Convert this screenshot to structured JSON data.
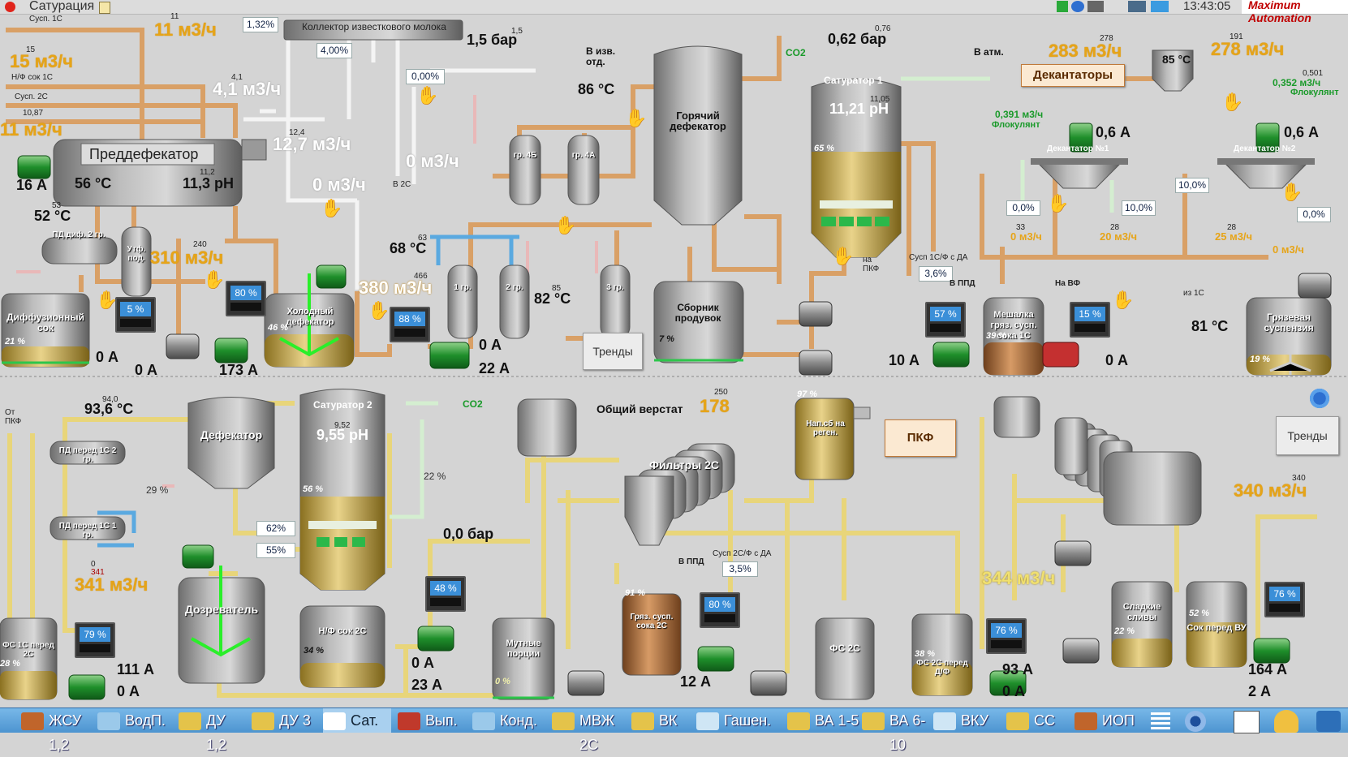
{
  "window": {
    "title": "Сатурация",
    "clock": "13:43:05",
    "logo": "Maximum Automation"
  },
  "top": {
    "collector": "Коллектор известкового молока",
    "predefecator": "Преддефекатор",
    "predefecator_temp": "56 °C",
    "predefecator_ph": "11,3 pH",
    "predefecator_ph_sp": "11,2",
    "flow_susp1c": "11 м3/ч",
    "flow_susp1c_sp": "11",
    "susp1c_label": "Сусп. 1С",
    "flow_nf": "15 м3/ч",
    "flow_nf_sp": "15",
    "nf_label": "Н/Ф сок 1С",
    "flow_susp2c": "11 м3/ч",
    "susp2c_label": "Сусп. 2С",
    "susp2c_sp": "10,87",
    "flow_lime": "4,1 м3/ч",
    "flow_lime_sp": "4,1",
    "flow_127": "12,7 м3/ч",
    "flow_127_sp": "12,4",
    "flow_0a": "0 м3/ч",
    "flow_0b": "0 м3/ч",
    "v2c_label": "В 2С",
    "pressure_15": "1,5 бар",
    "pressure_15_sp": "1,5",
    "to_lime": "В изв. отд.",
    "pct_132": "1,32%",
    "pct_400": "4,00%",
    "pct_000": "0,00%",
    "motor_16a": "16 А",
    "temp_52": "52 °C",
    "temp_52_sp": "53",
    "pd_dif": "ПД диф. 2 гр.",
    "utf": "Утф. под.",
    "flow_310": "310 м3/ч",
    "flow_310_sp": "240",
    "diffusion": "Диффузионный сок",
    "diffusion_pct": "21 %",
    "cold_def": "Холодный дефекатор",
    "cold_pct": "46 %",
    "flow_380": "380 м3/ч",
    "flow_380_sp": "466",
    "temp_68": "68 °C",
    "temp_68_sp": "63",
    "temp_82": "82 °C",
    "temp_82_sp": "85",
    "temp_86": "86 °C",
    "gr1": "1 гр.",
    "gr2": "2 гр.",
    "gr3": "3 гр.",
    "gr4b": "гр. 4Б",
    "gr4a": "гр. 4А",
    "hot_def": "Горячий дефекатор",
    "collector_def": "Сборник продувок",
    "collector_pct": "7 %",
    "trends1": "Тренды",
    "co2": "CO2",
    "to_atm": "В атм.",
    "pressure_062": "0,62 бар",
    "pressure_062_sp": "0,76",
    "saturator1": "Сатуратор 1",
    "sat1_ph": "11,21 pH",
    "sat1_ph_sp": "11,05",
    "sat1_pct": "65 %",
    "to_pkf": "на ПКФ",
    "susp1c_da": "Сусп 1С/Ф с ДА",
    "susp1c_da_val": "3,6%",
    "to_ppd": "В ППД",
    "mixer": "Мешалка гряз. сусп. сока 1С",
    "mixer_pct": "39 %",
    "to_vf": "На ВФ",
    "flow_283": "283 м3/ч",
    "flow_283_sp": "278",
    "temp_85": "85 °C",
    "flow_278": "278 м3/ч",
    "flow_278_sp": "191",
    "decanters": "Декантаторы",
    "floc1": "0,391 м3/ч",
    "floc1_lbl": "Флокулянт",
    "floc2": "0,352 м3/ч",
    "floc2_sp": "0,501",
    "floc2_lbl": "Флокулянт",
    "amp_06a": "0,6 А",
    "amp_06b": "0,6 А",
    "decanter1": "Декантатор №1",
    "decanter2": "Декантатор №2",
    "pct_100a": "10,0%",
    "pct_100b": "10,0%",
    "pct_00a": "0,0%",
    "pct_00b": "0,0%",
    "flow_dec_0": "0 м3/ч",
    "flow_dec_0_sp": "33",
    "flow_dec_20": "20 м3/ч",
    "flow_dec_20_sp": "28",
    "flow_dec_25": "25 м3/ч",
    "flow_dec_25_sp": "28",
    "flow_dec_00": "0 м3/ч",
    "dirty": "Грязевая суспензия",
    "dirty_pct": "19 %",
    "temp_81": "81 °C",
    "from1c": "из 1С",
    "amp_0a": "0 А",
    "amp_0b": "0 А",
    "amp_173": "173 А",
    "amp_0c": "0 А",
    "amp_22": "22 А",
    "amp_10": "10 А",
    "amp_0d": "0 А",
    "mon_5": "5 %",
    "mon_80": "80 %",
    "mon_88": "88 %",
    "mon_57": "57 %",
    "mon_15": "15 %"
  },
  "bottom": {
    "from_pkf": "От ПКФ",
    "temp_936": "93,6 °C",
    "temp_936_sp": "94,0",
    "pd_1c2": "ПД перед 1С 2 гр.",
    "pd_1c1": "ПД перед 1С 1 гр.",
    "defecator": "Дефекатор",
    "saturator2": "Сатуратор 2",
    "sat2_ph": "9,55 pH",
    "sat2_ph_sp": "9,52",
    "sat2_pct": "56 %",
    "co2": "CO2",
    "common": "Общий верстат",
    "common_val": "178",
    "common_sp": "250",
    "nap": "Нап.сб на реген.",
    "nap_pct": "97 %",
    "pkf": "ПКФ",
    "trends2": "Тренды",
    "flow_340": "340 м3/ч",
    "flow_340_sp": "340",
    "pct_62": "62%",
    "pct_55": "55%",
    "flow_341": "341 м3/ч",
    "flow_341_sp": "341",
    "flow_341_sp0": "0",
    "ripener": "Дозреватель",
    "nf2c": "Н/Ф сок 2С",
    "nf2c_pct": "34 %",
    "pressure_00": "0,0 бар",
    "filters2c": "Фильтры 2С",
    "susp2c_da": "Сусп 2С/Ф с ДА",
    "susp2c_da_val": "3,5%",
    "to_ppd": "В ППД",
    "flow_344": "344 м3/ч",
    "fs1c": "ФС 1С перед 2С",
    "fs1c_pct": "28 %",
    "muddy": "Мутные порции",
    "muddy_pct": "0 %",
    "dirty2c": "Гряз. сусп. сока 2С",
    "dirty2c_pct": "91 %",
    "fs2c": "ФС 2С",
    "fs2c_df": "ФС 2С перед Д/Ф",
    "fs2c_df_pct": "38 %",
    "sweet": "Сладкие сливы",
    "sweet_pct": "22 %",
    "juice_vu": "Сок перед ВУ",
    "juice_vu_pct": "52 %",
    "pct_29": "29 %",
    "pct_22": "22 %",
    "amp_111": "111 А",
    "amp_0e": "0 А",
    "amp_0f": "0 А",
    "amp_23": "23 А",
    "amp_12": "12 А",
    "amp_93": "93 А",
    "amp_0g": "0 А",
    "amp_164": "164 А",
    "amp_2": "2 А",
    "mon_79": "79 %",
    "mon_48": "48 %",
    "mon_80": "80 %",
    "mon_76a": "76 %",
    "mon_76b": "76 %"
  },
  "taskbar": [
    {
      "label": "ЖСУ 1,2",
      "color": "#c0652b"
    },
    {
      "label": "ВодП.",
      "color": "#7fb7e0"
    },
    {
      "label": "ДУ 1,2",
      "color": "#e4c34a"
    },
    {
      "label": "ДУ 3",
      "color": "#e4c34a"
    },
    {
      "label": "Сат.",
      "color": "#ffffff"
    },
    {
      "label": "Вып.",
      "color": "#c0392b"
    },
    {
      "label": "Конд.",
      "color": "#7fb7e0"
    },
    {
      "label": "МВЖ 2С",
      "color": "#e4c34a"
    },
    {
      "label": "ВК",
      "color": "#e4c34a"
    },
    {
      "label": "Гашен.",
      "color": "#cfe6f5"
    },
    {
      "label": "ВА 1-5",
      "color": "#e4c34a"
    },
    {
      "label": "ВА 6-10",
      "color": "#e4c34a"
    },
    {
      "label": "ВКУ",
      "color": "#cfe6f5"
    },
    {
      "label": "СС",
      "color": "#e4c34a"
    },
    {
      "label": "ИОП",
      "color": "#c0652b"
    }
  ]
}
